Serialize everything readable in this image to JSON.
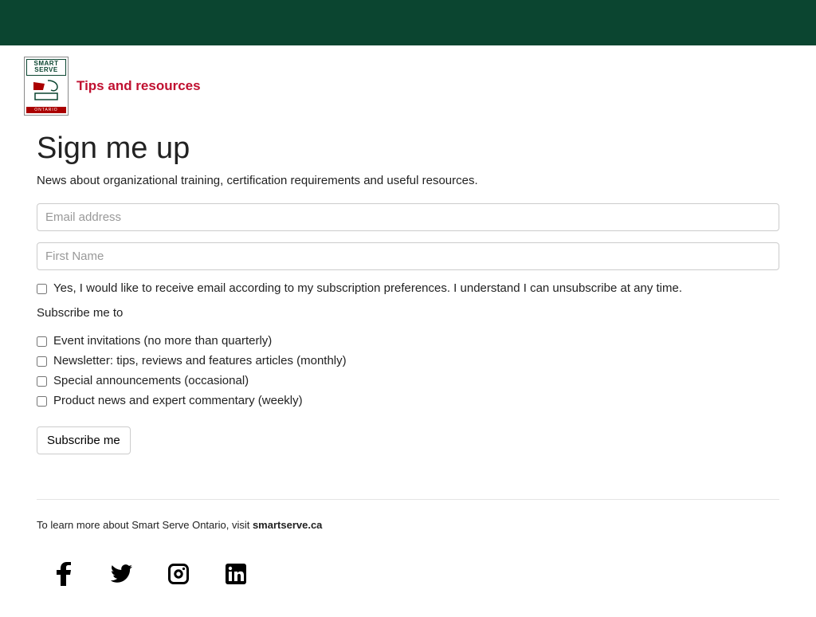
{
  "header": {
    "logo_line1": "SMART",
    "logo_line2": "SERVE",
    "logo_footer": "ONTARIO",
    "title": "Tips and resources"
  },
  "form": {
    "heading": "Sign me up",
    "subtitle": "News about organizational training, certification requirements and useful resources.",
    "email_placeholder": "Email address",
    "firstname_placeholder": "First Name",
    "consent_label": "Yes, I would like to receive email according to my subscription preferences. I understand I can unsubscribe at any time.",
    "subscribe_label": "Subscribe me to",
    "options": [
      "Event invitations (no more than quarterly)",
      "Newsletter: tips, reviews and features articles (monthly)",
      "Special announcements (occasional)",
      "Product news and expert commentary (weekly)"
    ],
    "submit_label": "Subscribe me"
  },
  "footer": {
    "text_prefix": "To learn more about Smart Serve Ontario, visit ",
    "link_text": "smartserve.ca"
  },
  "social": {
    "facebook": "facebook-icon",
    "twitter": "twitter-icon",
    "instagram": "instagram-icon",
    "linkedin": "linkedin-icon"
  },
  "colors": {
    "banner": "#0b4530",
    "accent": "#c01030"
  }
}
